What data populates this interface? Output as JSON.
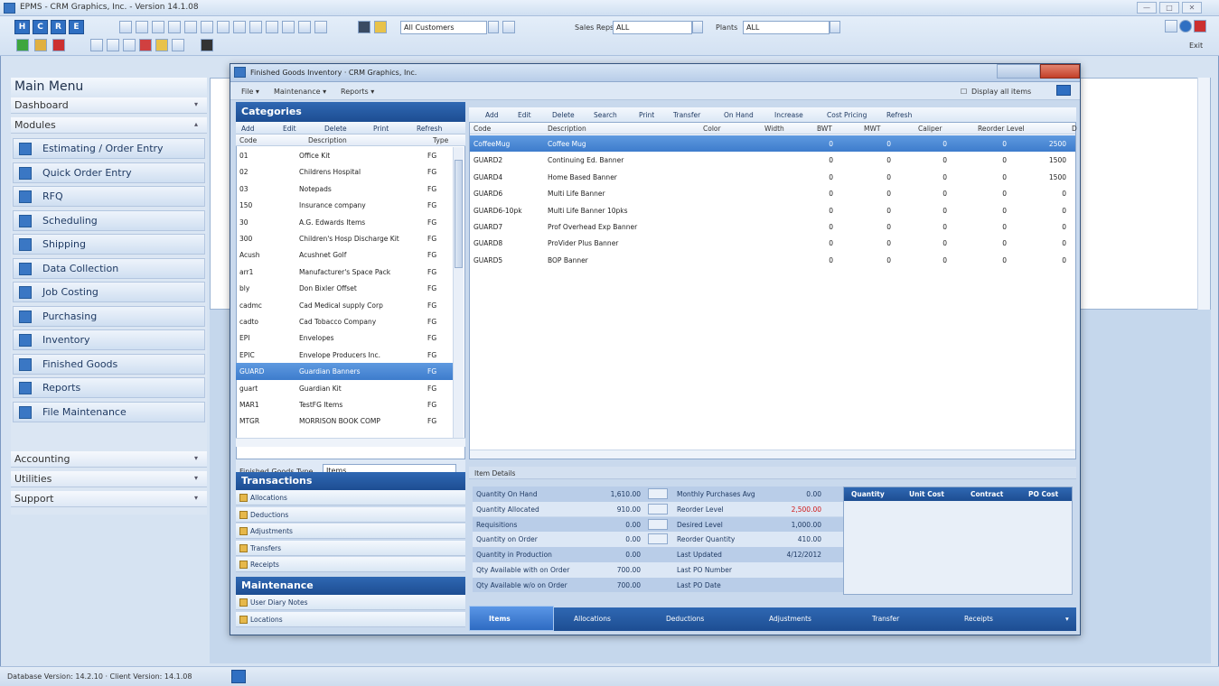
{
  "app": {
    "title": "EPMS - CRM Graphics, Inc. - Version 14.1.08",
    "toolbar": {
      "hcre": [
        "H",
        "C",
        "R",
        "E"
      ],
      "customers_value": "All Customers",
      "sales_reps_label": "Sales Reps",
      "sales_reps_value": "ALL",
      "plants_label": "Plants",
      "plants_value": "ALL",
      "exit_label": "Exit"
    },
    "sidebar": {
      "title": "Main Menu",
      "dashboard": "Dashboard",
      "modules": "Modules",
      "items": [
        {
          "label": "Estimating / Order Entry",
          "icon": "estimating-icon"
        },
        {
          "label": "Quick Order Entry",
          "icon": "quick-order-icon"
        },
        {
          "label": "RFQ",
          "icon": "rfq-icon"
        },
        {
          "label": "Scheduling",
          "icon": "scheduling-icon"
        },
        {
          "label": "Shipping",
          "icon": "shipping-icon"
        },
        {
          "label": "Data Collection",
          "icon": "data-collection-icon"
        },
        {
          "label": "Job Costing",
          "icon": "job-costing-icon"
        },
        {
          "label": "Purchasing",
          "icon": "purchasing-icon"
        },
        {
          "label": "Inventory",
          "icon": "inventory-icon"
        },
        {
          "label": "Finished Goods",
          "icon": "finished-goods-icon"
        },
        {
          "label": "Reports",
          "icon": "reports-icon"
        },
        {
          "label": "File Maintenance",
          "icon": "file-maintenance-icon"
        }
      ],
      "accounting": "Accounting",
      "utilities": "Utilities",
      "support": "Support"
    },
    "status_text": "Database Version: 14.2.10 · Client Version: 14.1.08"
  },
  "window": {
    "title": "Finished Goods Inventory · CRM Graphics, Inc.",
    "menu": [
      "File ▾",
      "Maintenance ▾",
      "Reports ▾"
    ],
    "display_all": "Display all items",
    "categories": {
      "title": "Categories",
      "buttons": [
        "Add",
        "Edit",
        "Delete",
        "Print",
        "Refresh"
      ],
      "headers": [
        "Code",
        "Description",
        "Type"
      ],
      "rows": [
        [
          "01",
          "Office Kit",
          "FG"
        ],
        [
          "02",
          "Childrens Hospital",
          "FG"
        ],
        [
          "03",
          "Notepads",
          "FG"
        ],
        [
          "150",
          "Insurance company",
          "FG"
        ],
        [
          "30",
          "A.G. Edwards Items",
          "FG"
        ],
        [
          "300",
          "Children's Hosp Discharge Kit",
          "FG"
        ],
        [
          "Acush",
          "Acushnet Golf",
          "FG"
        ],
        [
          "arr1",
          "Manufacturer's Space Pack",
          "FG"
        ],
        [
          "bly",
          "Don Bixler Offset",
          "FG"
        ],
        [
          "cadmc",
          "Cad Medical supply Corp",
          "FG"
        ],
        [
          "cadto",
          "Cad Tobacco Company",
          "FG"
        ],
        [
          "EPI",
          "Envelopes",
          "FG"
        ],
        [
          "EPIC",
          "Envelope Producers Inc.",
          "FG"
        ],
        [
          "GUARD",
          "Guardian Banners",
          "FG"
        ],
        [
          "guart",
          "Guardian Kit",
          "FG"
        ],
        [
          "MAR1",
          "TestFG Items",
          "FG"
        ],
        [
          "MTGR",
          "MORRISON BOOK COMP",
          "FG"
        ]
      ],
      "selected_index": 13,
      "fg_type_label": "Finished Goods Type",
      "fg_type_value": "Items"
    },
    "transactions": {
      "title": "Transactions",
      "items": [
        "Allocations",
        "Deductions",
        "Adjustments",
        "Transfers",
        "Receipts"
      ]
    },
    "maintenance": {
      "title": "Maintenance",
      "items": [
        "User Diary Notes",
        "Locations"
      ]
    },
    "items_toolbar": [
      "Add",
      "Edit",
      "Delete",
      "Search",
      "Print",
      "Transfer",
      "On Hand",
      "Increase",
      "Cost Pricing",
      "Refresh"
    ],
    "items": {
      "headers": [
        "Code",
        "Description",
        "Color",
        "Width",
        "BWT",
        "MWT",
        "Caliper",
        "Reorder Level",
        "D"
      ],
      "rows": [
        [
          "CoffeeMug",
          "Coffee Mug",
          "",
          "",
          "0",
          "0",
          "0",
          "0",
          "2500"
        ],
        [
          "GUARD2",
          "Continuing Ed. Banner",
          "",
          "",
          "0",
          "0",
          "0",
          "0",
          "1500"
        ],
        [
          "GUARD4",
          "Home Based Banner",
          "",
          "",
          "0",
          "0",
          "0",
          "0",
          "1500"
        ],
        [
          "GUARD6",
          "Multi Life Banner",
          "",
          "",
          "0",
          "0",
          "0",
          "0",
          "0"
        ],
        [
          "GUARD6-10pk",
          "Multi Life Banner 10pks",
          "",
          "",
          "0",
          "0",
          "0",
          "0",
          "0"
        ],
        [
          "GUARD7",
          "Prof Overhead Exp Banner",
          "",
          "",
          "0",
          "0",
          "0",
          "0",
          "0"
        ],
        [
          "GUARD8",
          "ProVider Plus Banner",
          "",
          "",
          "0",
          "0",
          "0",
          "0",
          "0"
        ],
        [
          "GUARD5",
          "BOP Banner",
          "",
          "",
          "0",
          "0",
          "0",
          "0",
          "0"
        ]
      ],
      "selected_index": 0
    },
    "details": {
      "title": "Item Details",
      "left": [
        [
          "Quantity On Hand",
          "1,610.00"
        ],
        [
          "Quantity Allocated",
          "910.00"
        ],
        [
          "Requisitions",
          "0.00"
        ],
        [
          "Quantity on Order",
          "0.00"
        ],
        [
          "Quantity in Production",
          "0.00"
        ],
        [
          "Qty Available with on Order",
          "700.00"
        ],
        [
          "Qty Available w/o on Order",
          "700.00"
        ]
      ],
      "right": [
        [
          "Monthly Purchases Avg",
          "0.00"
        ],
        [
          "Reorder Level",
          "2,500.00"
        ],
        [
          "Desired Level",
          "1,000.00"
        ],
        [
          "Reorder Quantity",
          "410.00"
        ],
        [
          "Last Updated",
          "4/12/2012"
        ],
        [
          "Last PO Number",
          ""
        ],
        [
          "Last PO Date",
          ""
        ]
      ],
      "reorder_color": "#d01818",
      "cost_headers": [
        "Quantity",
        "Unit Cost",
        "Contract",
        "PO Cost"
      ]
    },
    "bottom_tabs": [
      "Items",
      "Allocations",
      "Deductions",
      "Adjustments",
      "Transfer",
      "Receipts"
    ]
  }
}
